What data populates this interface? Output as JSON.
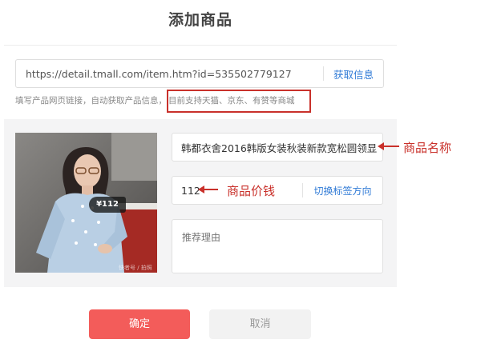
{
  "dialog": {
    "title": "添加商品"
  },
  "url_field": {
    "value": "https://detail.tmall.com/item.htm?id=535502779127",
    "fetch_label": "获取信息"
  },
  "hint": {
    "text": "填写产品网页链接，自动获取产品信息，",
    "highlight": "目前支持天猫、京东、有赞等商城"
  },
  "product": {
    "price_tag": "¥112",
    "watermark": "快者号 / 拍照"
  },
  "fields": {
    "name_value": "韩都衣舍2016韩版女装秋装新款宽松圆领显",
    "price_value": "112",
    "switch_label": "切换标签方向",
    "reason_placeholder": "推荐理由"
  },
  "annotations": {
    "name_label": "商品名称",
    "price_label": "商品价钱",
    "color": "#c9312b"
  },
  "actions": {
    "confirm_label": "确定",
    "cancel_label": "取消"
  },
  "colors": {
    "accent_blue": "#2f7ad6",
    "confirm_red": "#f35c5a",
    "panel_gray": "#f4f4f5"
  }
}
